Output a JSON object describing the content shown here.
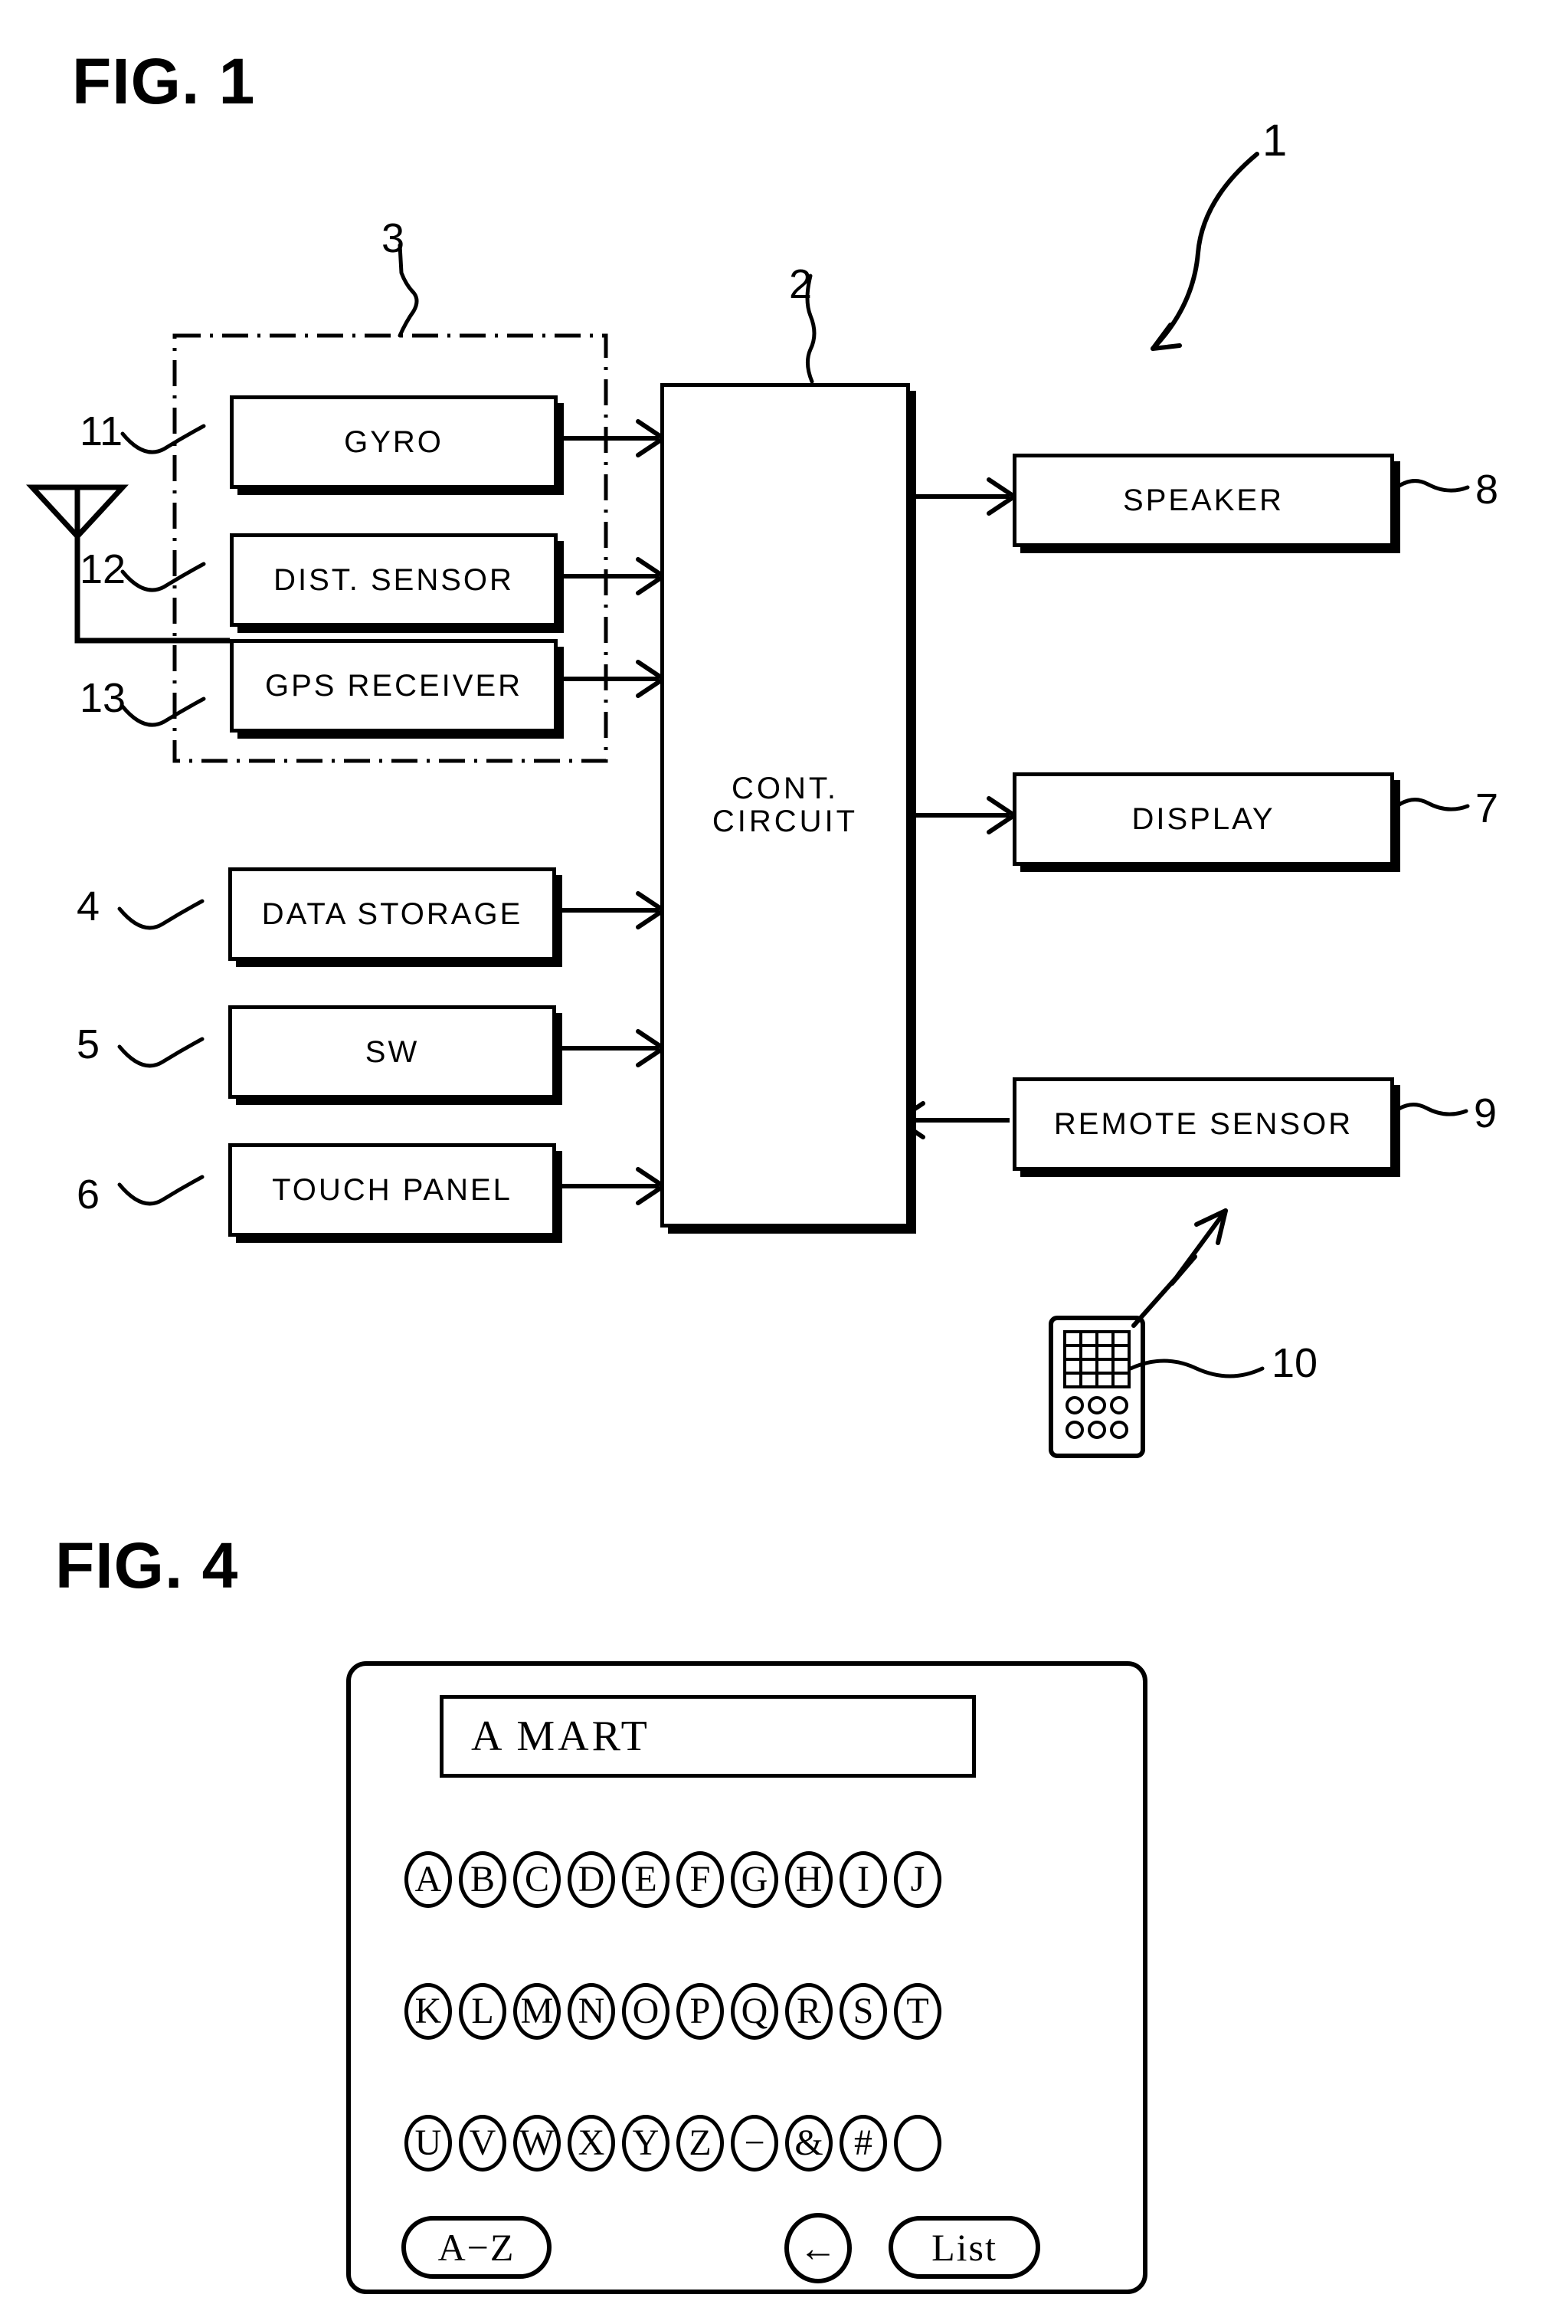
{
  "figures": [
    {
      "id": "fig1",
      "title": "FIG. 1"
    },
    {
      "id": "fig4",
      "title": "FIG. 4"
    }
  ],
  "fig1": {
    "title": "FIG. 1",
    "system_ref": "1",
    "sensor_group_ref": "3",
    "blocks": {
      "gyro": {
        "label": "GYRO",
        "ref": "11"
      },
      "dist_sensor": {
        "label": "DIST. SENSOR",
        "ref": "12"
      },
      "gps_receiver": {
        "label": "GPS RECEIVER",
        "ref": "13"
      },
      "data_storage": {
        "label": "DATA STORAGE",
        "ref": "4"
      },
      "sw": {
        "label": "SW",
        "ref": "5"
      },
      "touch_panel": {
        "label": "TOUCH PANEL",
        "ref": "6"
      },
      "cont_circuit": {
        "label_line1": "CONT.",
        "label_line2": "CIRCUIT",
        "ref": "2"
      },
      "speaker": {
        "label": "SPEAKER",
        "ref": "8"
      },
      "display": {
        "label": "DISPLAY",
        "ref": "7"
      },
      "remote_sensor": {
        "label": "REMOTE SENSOR",
        "ref": "9"
      },
      "remote_control": {
        "label": "",
        "ref": "10"
      }
    },
    "remote_control": {
      "grid_rows": 4,
      "grid_cols": 4,
      "button_rows": 2,
      "button_cols": 3
    }
  },
  "fig4": {
    "title": "FIG. 4",
    "search_field": {
      "value": "A  MART",
      "placeholder": ""
    },
    "key_rows": [
      [
        "A",
        "B",
        "C",
        "D",
        "E",
        "F",
        "G",
        "H",
        "I",
        "J"
      ],
      [
        "K",
        "L",
        "M",
        "N",
        "O",
        "P",
        "Q",
        "R",
        "S",
        "T"
      ],
      [
        "U",
        "V",
        "W",
        "X",
        "Y",
        "Z",
        "−",
        "&",
        "#",
        ""
      ]
    ],
    "bottom_row": {
      "range_button": "A−Z",
      "backspace_icon": "←",
      "list_button": "List"
    }
  },
  "colors": {
    "ink": "#000000",
    "paper": "#ffffff"
  }
}
